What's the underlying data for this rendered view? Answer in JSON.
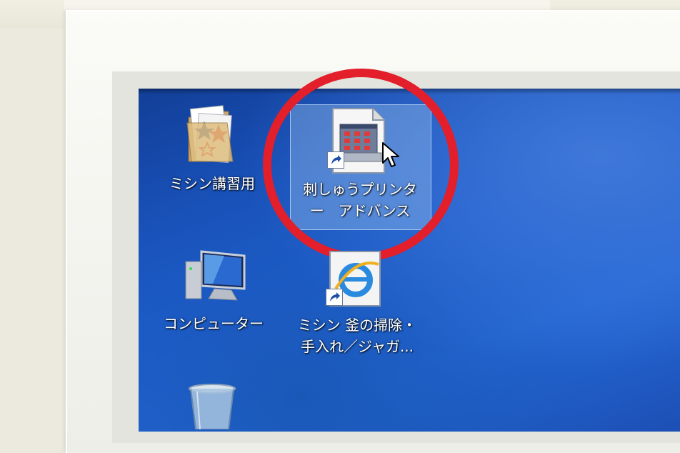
{
  "desktop": {
    "icons": [
      {
        "name": "folder",
        "label_lines": [
          "ミシン講習用"
        ]
      },
      {
        "name": "app-shortcut",
        "label_lines": [
          "刺しゅうプリンタ",
          "ー　アドバンス"
        ],
        "selected": true
      },
      {
        "name": "computer",
        "label_lines": [
          "コンピューター"
        ]
      },
      {
        "name": "ie-shortcut",
        "label_lines": [
          "ミシン 釜の掃除・",
          "手入れ／ジャガ..."
        ]
      },
      {
        "name": "recycle-bin",
        "label_lines": [
          ""
        ]
      }
    ]
  },
  "colors": {
    "highlight_circle": "#e21f2a",
    "desktop_blue": "#1d5ccf",
    "bezel": "#f5f5f0"
  }
}
